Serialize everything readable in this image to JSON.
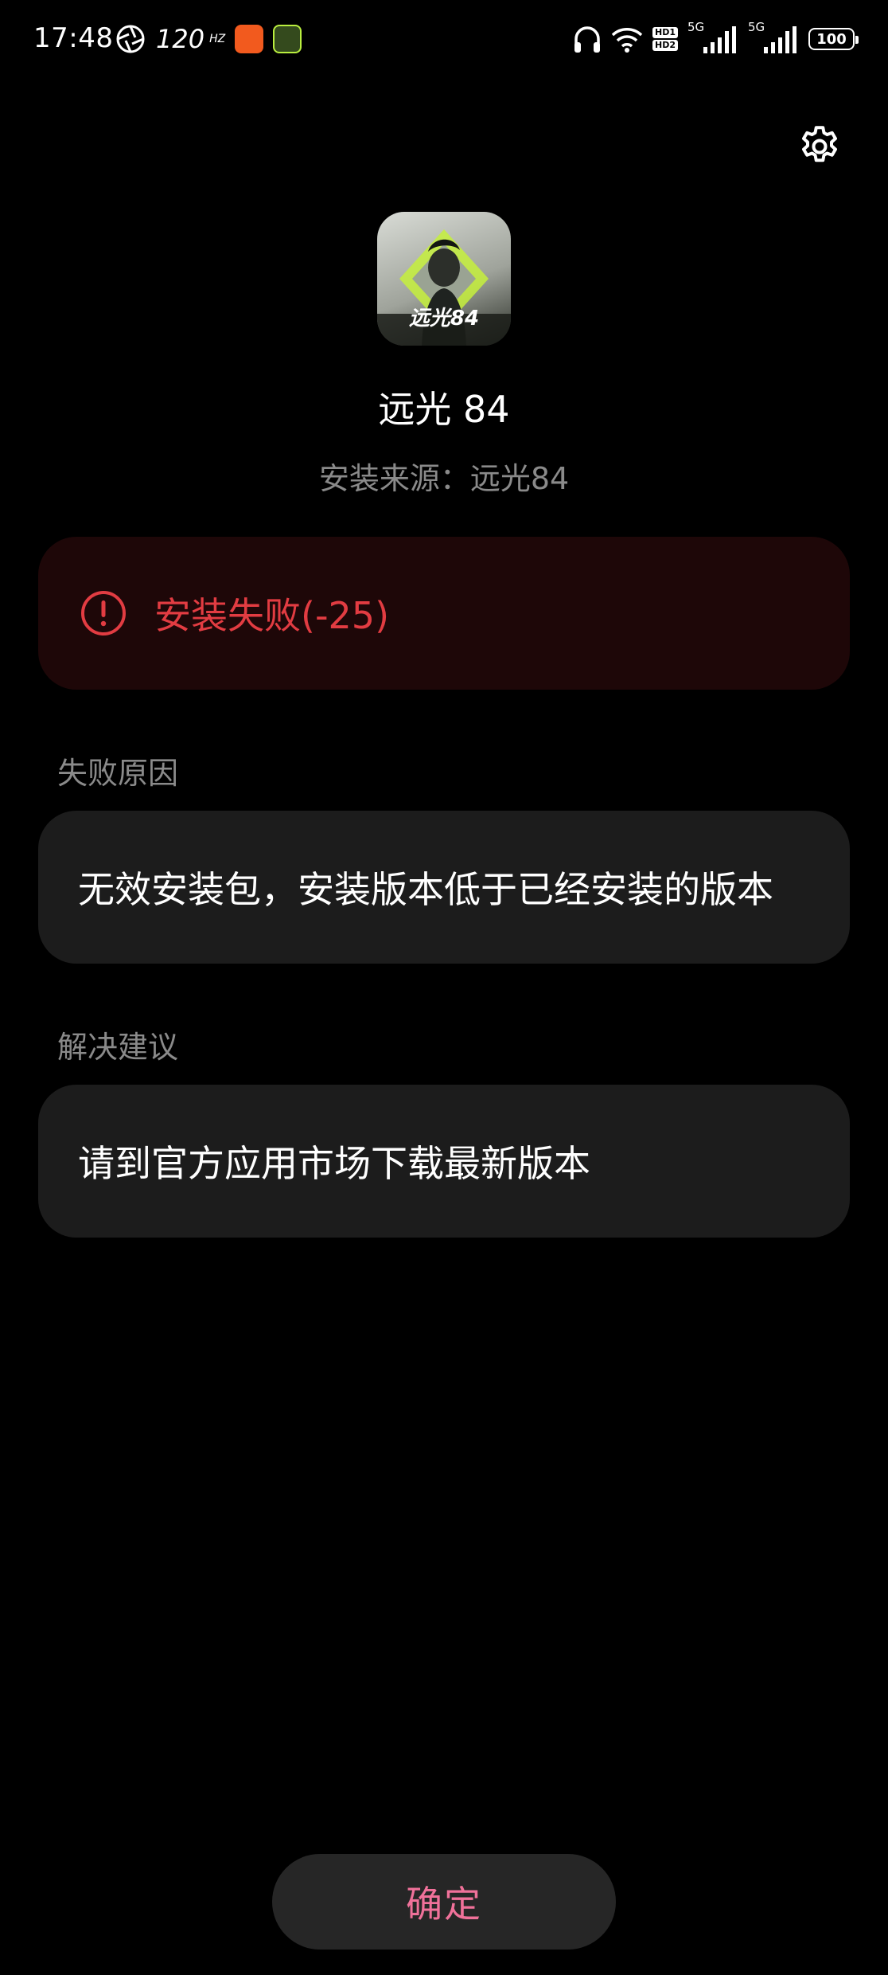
{
  "status_bar": {
    "time": "17:48",
    "refresh_rate": "120",
    "refresh_unit": "HZ",
    "hd1": "HD1",
    "hd2": "HD2",
    "signal1_label": "5G",
    "signal2_label": "5G",
    "battery": "100"
  },
  "app": {
    "name": "远光 84",
    "icon_logo_text": "远光84",
    "install_source": "安装来源：远光84"
  },
  "error": {
    "message": "安装失败(-25)",
    "color": "#e23c42"
  },
  "failure_reason": {
    "label": "失败原因",
    "text": "无效安装包，安装版本低于已经安装的版本"
  },
  "suggestion": {
    "label": "解决建议",
    "text": "请到官方应用市场下载最新版本"
  },
  "confirm_button": {
    "label": "确定",
    "color": "#f0719a"
  },
  "icons": {
    "settings": "gear-icon",
    "error": "exclamation-circle-icon"
  }
}
